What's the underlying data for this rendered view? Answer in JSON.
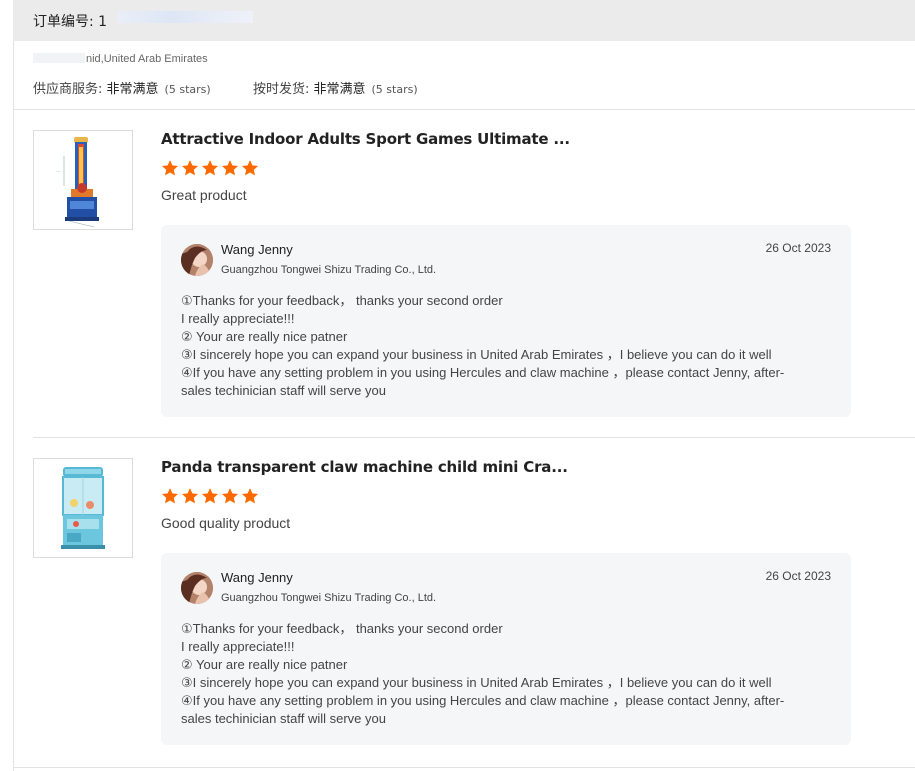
{
  "order": {
    "label": "订单编号: 1"
  },
  "buyer": {
    "country": "nid,United Arab Emirates",
    "supplier_service_label": "供应商服务:",
    "supplier_service_value": "非常满意",
    "supplier_service_stars": "(5 stars)",
    "ontime_label": "按时发货:",
    "ontime_value": "非常满意",
    "ontime_stars": "(5 stars)"
  },
  "colors": {
    "star": "#ff6a00",
    "reply_bg": "#f5f6f8",
    "order_bar_bg": "#ebebeb"
  },
  "reviews": [
    {
      "title": "Attractive Indoor Adults Sport Games Ultimate ...",
      "rating": 5,
      "comment": "Great product",
      "thumbnail_icon": "boxing-machine-image",
      "reply": {
        "name": "Wang Jenny",
        "company": "Guangzhou Tongwei Shizu Trading Co., Ltd.",
        "date": "26 Oct 2023",
        "lines": [
          "①Thanks for your feedback， thanks your second order",
          "I really  appreciate!!!",
          "② Your are  really  nice patner",
          "③I sincerely hope you can expand your business in United Arab Emirates ，I believe you can do it well",
          "④If you have any setting problem in you using Hercules  and claw machine ，please contact Jenny, after-",
          "sales techinician staff will serve you"
        ]
      }
    },
    {
      "title": "Panda transparent claw machine child mini Cra...",
      "rating": 5,
      "comment": "Good quality product",
      "thumbnail_icon": "claw-machine-image",
      "reply": {
        "name": "Wang Jenny",
        "company": "Guangzhou Tongwei Shizu Trading Co., Ltd.",
        "date": "26 Oct 2023",
        "lines": [
          "①Thanks for your feedback， thanks your second order",
          "I really  appreciate!!!",
          "② Your are  really  nice patner",
          "③I sincerely hope you can expand your business in United Arab Emirates ，I believe you can do it well",
          "④If you have any setting problem in you using Hercules  and claw machine ，please contact Jenny, after-",
          "sales techinician staff will serve you"
        ]
      }
    }
  ]
}
